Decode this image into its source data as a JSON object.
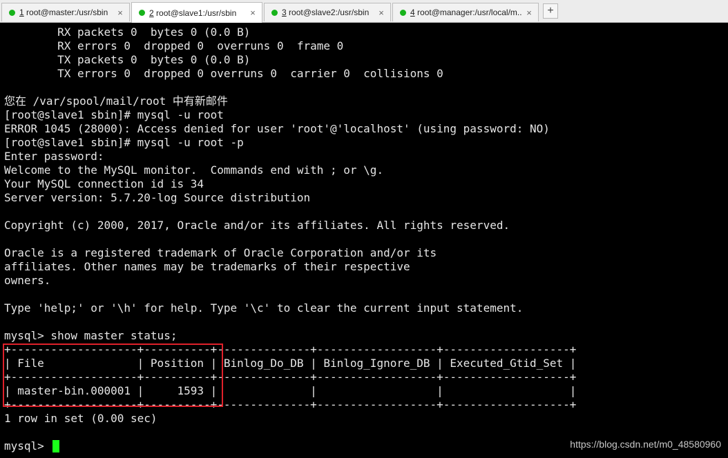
{
  "tabs": [
    {
      "num": "1",
      "title": " root@master:/usr/sbin",
      "close": "×",
      "active": false
    },
    {
      "num": "2",
      "title": " root@slave1:/usr/sbin",
      "close": "×",
      "active": true
    },
    {
      "num": "3",
      "title": " root@slave2:/usr/sbin",
      "close": "×",
      "active": false
    },
    {
      "num": "4",
      "title": " root@manager:/usr/local/m...",
      "close": "×",
      "active": false
    }
  ],
  "add_tab_label": "+",
  "status_color": "#17b31b",
  "terminal": {
    "lines": [
      "        RX packets 0  bytes 0 (0.0 B)",
      "        RX errors 0  dropped 0  overruns 0  frame 0",
      "        TX packets 0  bytes 0 (0.0 B)",
      "        TX errors 0  dropped 0 overruns 0  carrier 0  collisions 0",
      "",
      "您在 /var/spool/mail/root 中有新邮件",
      "[root@slave1 sbin]# mysql -u root",
      "ERROR 1045 (28000): Access denied for user 'root'@'localhost' (using password: NO)",
      "[root@slave1 sbin]# mysql -u root -p",
      "Enter password:",
      "Welcome to the MySQL monitor.  Commands end with ; or \\g.",
      "Your MySQL connection id is 34",
      "Server version: 5.7.20-log Source distribution",
      "",
      "Copyright (c) 2000, 2017, Oracle and/or its affiliates. All rights reserved.",
      "",
      "Oracle is a registered trademark of Oracle Corporation and/or its",
      "affiliates. Other names may be trademarks of their respective",
      "owners.",
      "",
      "Type 'help;' or '\\h' for help. Type '\\c' to clear the current input statement.",
      "",
      "mysql> show master status;",
      "+-------------------+----------+--------------+------------------+-------------------+",
      "| File              | Position | Binlog_Do_DB | Binlog_Ignore_DB | Executed_Gtid_Set |",
      "+-------------------+----------+--------------+------------------+-------------------+",
      "| master-bin.000001 |     1593 |              |                  |                   |",
      "+-------------------+----------+--------------+------------------+-------------------+",
      "1 row in set (0.00 sec)",
      "",
      "mysql> "
    ],
    "cursor_color": "#1aff1a"
  },
  "annotation_color": "#e0202a",
  "watermark": "https://blog.csdn.net/m0_48580960"
}
